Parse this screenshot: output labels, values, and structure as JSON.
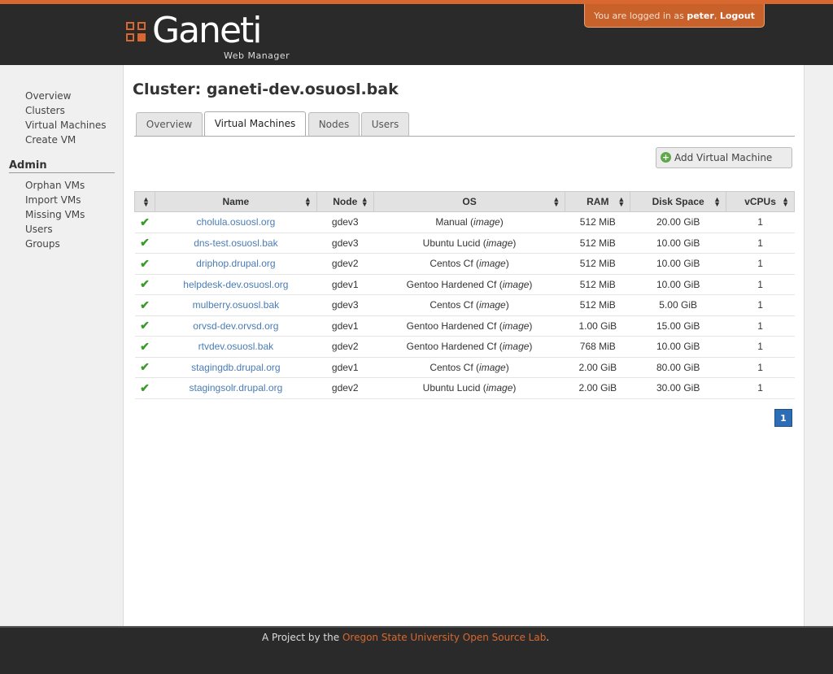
{
  "header": {
    "logo_text": "Ganeti",
    "logo_subtitle": "Web Manager",
    "login_prefix": "You are logged in as",
    "username": "peter",
    "logout_label": "Logout"
  },
  "sidebar": {
    "items": [
      "Overview",
      "Clusters",
      "Virtual Machines",
      "Create VM"
    ],
    "admin_heading": "Admin",
    "admin_items": [
      "Orphan VMs",
      "Import VMs",
      "Missing VMs",
      "Users",
      "Groups"
    ]
  },
  "main": {
    "title": "Cluster: ganeti-dev.osuosl.bak",
    "tabs": [
      {
        "label": "Overview",
        "active": false
      },
      {
        "label": "Virtual Machines",
        "active": true
      },
      {
        "label": "Nodes",
        "active": false
      },
      {
        "label": "Users",
        "active": false
      }
    ],
    "add_button": "Add Virtual Machine",
    "table": {
      "columns": [
        "",
        "Name",
        "Node",
        "OS",
        "RAM",
        "Disk Space",
        "vCPUs"
      ],
      "rows": [
        {
          "name": "cholula.osuosl.org",
          "node": "gdev3",
          "os": "Manual",
          "os_suffix": "image",
          "ram": "512 MiB",
          "disk": "20.00 GiB",
          "vcpus": "1"
        },
        {
          "name": "dns-test.osuosl.bak",
          "node": "gdev3",
          "os": "Ubuntu Lucid",
          "os_suffix": "image",
          "ram": "512 MiB",
          "disk": "10.00 GiB",
          "vcpus": "1"
        },
        {
          "name": "driphop.drupal.org",
          "node": "gdev2",
          "os": "Centos Cf",
          "os_suffix": "image",
          "ram": "512 MiB",
          "disk": "10.00 GiB",
          "vcpus": "1"
        },
        {
          "name": "helpdesk-dev.osuosl.org",
          "node": "gdev1",
          "os": "Gentoo Hardened Cf",
          "os_suffix": "image",
          "ram": "512 MiB",
          "disk": "10.00 GiB",
          "vcpus": "1"
        },
        {
          "name": "mulberry.osuosl.bak",
          "node": "gdev3",
          "os": "Centos Cf",
          "os_suffix": "image",
          "ram": "512 MiB",
          "disk": "5.00 GiB",
          "vcpus": "1"
        },
        {
          "name": "orvsd-dev.orvsd.org",
          "node": "gdev1",
          "os": "Gentoo Hardened Cf",
          "os_suffix": "image",
          "ram": "1.00 GiB",
          "disk": "15.00 GiB",
          "vcpus": "1"
        },
        {
          "name": "rtvdev.osuosl.bak",
          "node": "gdev2",
          "os": "Gentoo Hardened Cf",
          "os_suffix": "image",
          "ram": "768 MiB",
          "disk": "10.00 GiB",
          "vcpus": "1"
        },
        {
          "name": "stagingdb.drupal.org",
          "node": "gdev1",
          "os": "Centos Cf",
          "os_suffix": "image",
          "ram": "2.00 GiB",
          "disk": "80.00 GiB",
          "vcpus": "1"
        },
        {
          "name": "stagingsolr.drupal.org",
          "node": "gdev2",
          "os": "Ubuntu Lucid",
          "os_suffix": "image",
          "ram": "2.00 GiB",
          "disk": "30.00 GiB",
          "vcpus": "1"
        }
      ]
    },
    "page_number": "1"
  },
  "footer": {
    "prefix": "A Project by the",
    "link": "Oregon State University Open Source Lab",
    "suffix": "."
  },
  "colors": {
    "accent": "#d8682f",
    "header_bg": "#2a2a2a",
    "link": "#4a7cb5",
    "pager": "#2d6db5",
    "status_ok": "#3a9a2a"
  },
  "icons": {
    "status": "check-icon",
    "sort": "sort-icon",
    "add": "plus-circle-icon"
  }
}
